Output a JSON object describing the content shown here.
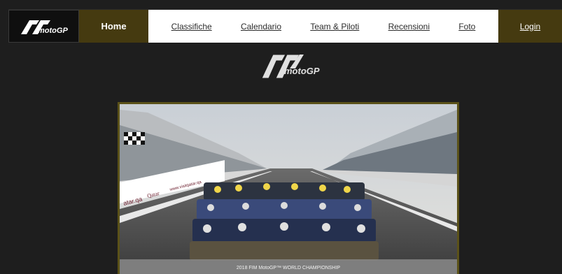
{
  "nav": {
    "home": "Home",
    "links": [
      "Classifiche",
      "Calendario",
      "Team & Piloti",
      "Recensioni",
      "Foto"
    ],
    "login": "Login"
  },
  "logo": {
    "icon": "motogp-logo-icon",
    "text": "motoGP"
  },
  "banner": {
    "caption": "2018 FIM MotoGP™ WORLD CHAMPIONSHIP",
    "ad_texts": [
      "atar.qa",
      "Qatar",
      "www.visitqatar.qa"
    ]
  },
  "colors": {
    "accent": "#453a10",
    "frame": "#5b5219",
    "background": "#1e1e1e"
  }
}
